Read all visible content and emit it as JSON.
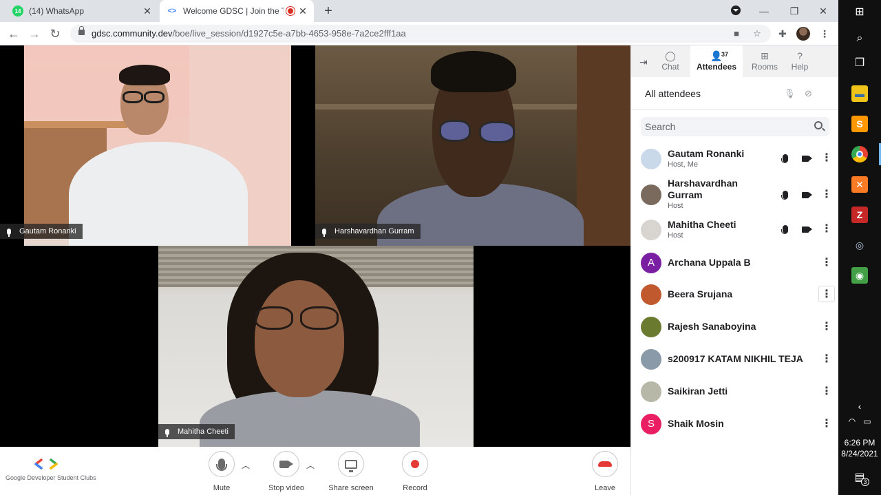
{
  "browser": {
    "tabs": [
      {
        "title": "(14) WhatsApp",
        "badge": "14",
        "active": false
      },
      {
        "title": "Welcome GDSC | Join the TE...",
        "active": true
      }
    ],
    "url_host": "gdsc.community.dev",
    "url_path": "/boe/live_session/d1927c5e-a7bb-4653-958e-7a2ce2fff1aa"
  },
  "participants_tiles": [
    {
      "name": "Gautam Ronanki"
    },
    {
      "name": "Harshavardhan Gurram"
    },
    {
      "name": "Mahitha Cheeti"
    }
  ],
  "controls": {
    "brand": "Google Developer Student Clubs",
    "mute": "Mute",
    "stop_video": "Stop video",
    "share_screen": "Share screen",
    "record": "Record",
    "leave": "Leave"
  },
  "sidebar": {
    "tabs": {
      "chat": "Chat",
      "attendees": "Attendees",
      "rooms": "Rooms",
      "help": "Help"
    },
    "attendee_count": "37",
    "header": "All attendees",
    "search_placeholder": "Search",
    "attendees": [
      {
        "name": "Gautam Ronanki",
        "role": "Host, Me",
        "initial": "",
        "color": "#c9d9ea"
      },
      {
        "name": "Harshavardhan Gurram",
        "role": "Host",
        "initial": "",
        "color": "#7a6a5e"
      },
      {
        "name": "Mahitha Cheeti",
        "role": "Host",
        "initial": "",
        "color": "#d8d4d0"
      },
      {
        "name": "Archana Uppala B",
        "role": "",
        "initial": "A",
        "color": "#7b1fa2"
      },
      {
        "name": "Beera Srujana",
        "role": "",
        "initial": "",
        "color": "#c05a2e"
      },
      {
        "name": "Rajesh Sanaboyina",
        "role": "",
        "initial": "",
        "color": "#6a7a2e"
      },
      {
        "name": "s200917 KATAM NIKHIL TEJA",
        "role": "",
        "initial": "",
        "color": "#8a9aa8"
      },
      {
        "name": "Saikiran Jetti",
        "role": "",
        "initial": "",
        "color": "#b8b8a8"
      },
      {
        "name": "Shaik Mosin",
        "role": "",
        "initial": "S",
        "color": "#e91e63"
      }
    ]
  },
  "system": {
    "time": "6:26 PM",
    "date": "8/24/2021",
    "notifications": "3"
  }
}
